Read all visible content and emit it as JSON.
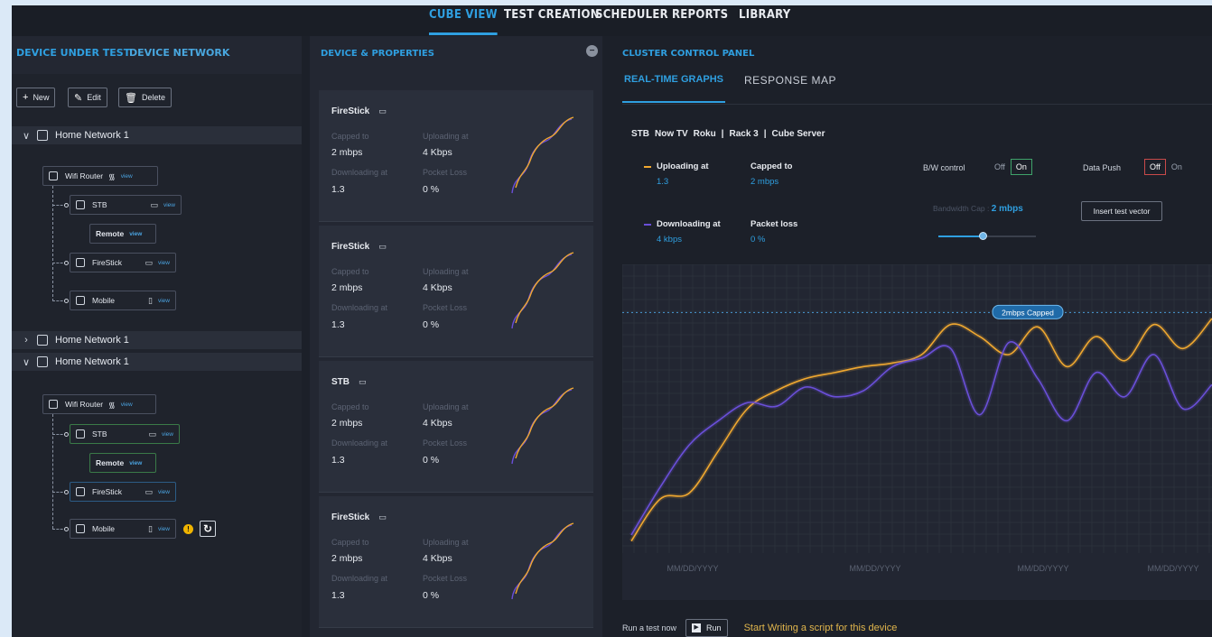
{
  "nav": {
    "tabs": [
      {
        "label": "CUBE VIEW",
        "active": true
      },
      {
        "label": "TEST CREATION",
        "active": false
      },
      {
        "label": "SCHEDULER",
        "active": false
      },
      {
        "label": "REPORTS",
        "active": false
      },
      {
        "label": "LIBRARY",
        "active": false
      }
    ]
  },
  "left": {
    "tabs": [
      "DEVICE UNDER TEST",
      "DEVICE NETWORK"
    ],
    "toolbar": {
      "new": "New",
      "edit": "Edit",
      "delete": "Delete"
    },
    "networks": [
      {
        "name": "Home Network 1",
        "expanded": true,
        "router": {
          "name": "Wifi Router",
          "view": "view"
        },
        "devices": [
          {
            "name": "STB",
            "view": "view",
            "remote": "Remote"
          },
          {
            "name": "FireStick",
            "view": "view"
          },
          {
            "name": "Mobile",
            "view": "view"
          }
        ]
      },
      {
        "name": "Home Network 1",
        "expanded": false
      },
      {
        "name": "Home Network 1",
        "expanded": true,
        "router": {
          "name": "Wifi Router",
          "view": "view"
        },
        "devices": [
          {
            "name": "STB",
            "view": "view",
            "remote": "Remote"
          },
          {
            "name": "FireStick",
            "view": "view"
          },
          {
            "name": "Mobile",
            "view": "view",
            "warning": "!"
          }
        ]
      }
    ]
  },
  "middle": {
    "title": "DEVICE & PROPERTIES",
    "collapse": "−",
    "cards": [
      {
        "name": "FireStick",
        "capped_label": "Capped to",
        "capped": "2 mbps",
        "uploading_label": "Uploading at",
        "uploading": "4 Kbps",
        "downloading_label": "Downloading at",
        "downloading": "1.3",
        "loss_label": "Pocket Loss",
        "loss": "0 %"
      },
      {
        "name": "FireStick",
        "capped_label": "Capped to",
        "capped": "2 mbps",
        "uploading_label": "Uploading at",
        "uploading": "4 Kbps",
        "downloading_label": "Downloading at",
        "downloading": "1.3",
        "loss_label": "Pocket Loss",
        "loss": "0 %"
      },
      {
        "name": "STB",
        "capped_label": "Capped to",
        "capped": "2 mbps",
        "uploading_label": "Uploading at",
        "uploading": "4 Kbps",
        "downloading_label": "Downloading at",
        "downloading": "1.3",
        "loss_label": "Pocket Loss",
        "loss": "0 %"
      },
      {
        "name": "FireStick",
        "capped_label": "Capped to",
        "capped": "2 mbps",
        "uploading_label": "Uploading at",
        "uploading": "4 Kbps",
        "downloading_label": "Downloading at",
        "downloading": "1.3",
        "loss_label": "Pocket Loss",
        "loss": "0 %"
      }
    ]
  },
  "right": {
    "title": "CLUSTER CONTROL PANEL",
    "tabs": [
      {
        "label": "REAL-TIME GRAPHS",
        "active": true
      },
      {
        "label": "RESPONSE MAP",
        "active": false
      }
    ],
    "breadcrumb": [
      "STB",
      "Now TV",
      "Roku",
      "|",
      "Rack 3",
      "|",
      "Cube Server"
    ],
    "metrics": {
      "uploading_label": "Uploading at",
      "uploading": "1.3",
      "capped_label": "Capped to",
      "capped": "2 mbps",
      "downloading_label": "Downloading at",
      "downloading": "4 kbps",
      "loss_label": "Packet loss",
      "loss": "0 %"
    },
    "controls": {
      "bw_label": "B/W control",
      "bw_off": "Off",
      "bw_on": "On",
      "push_label": "Data Push",
      "push_off": "Off",
      "push_on": "On",
      "bwcap_label": "Bandwidth Cap :",
      "bwcap_value": "2 mbps",
      "slider_level": 0.45,
      "insert": "Insert test vector"
    },
    "footer": {
      "run_label": "Run a test now",
      "run_button": "Run",
      "script": "Start Writing a script for this device"
    }
  },
  "colors": {
    "accent": "#2f9fe0",
    "upload": "#f0a830",
    "download": "#6a4fd8"
  },
  "chart_data": {
    "type": "line",
    "x": [
      "MM/DD/YYYY",
      "MM/DD/YYYY",
      "MM/DD/YYYY",
      "MM/DD/YYYY"
    ],
    "cap_label": "2mbps Capped",
    "cap_value": 2.0,
    "ylim": [
      0,
      2.4
    ],
    "grid": true,
    "series": [
      {
        "color": "#f0a830",
        "values": [
          0.1,
          0.45,
          0.5,
          0.85,
          1.2,
          1.35,
          1.45,
          1.5,
          1.55,
          1.58,
          1.65,
          1.9,
          1.8,
          1.65,
          1.88,
          1.55,
          1.8,
          1.6,
          1.9,
          1.7,
          1.95
        ]
      },
      {
        "color": "#6a4fd8",
        "values": [
          0.15,
          0.55,
          0.9,
          1.1,
          1.25,
          1.22,
          1.38,
          1.3,
          1.35,
          1.55,
          1.62,
          1.7,
          1.15,
          1.75,
          1.45,
          1.1,
          1.5,
          1.3,
          1.65,
          1.2,
          1.4
        ]
      }
    ]
  }
}
